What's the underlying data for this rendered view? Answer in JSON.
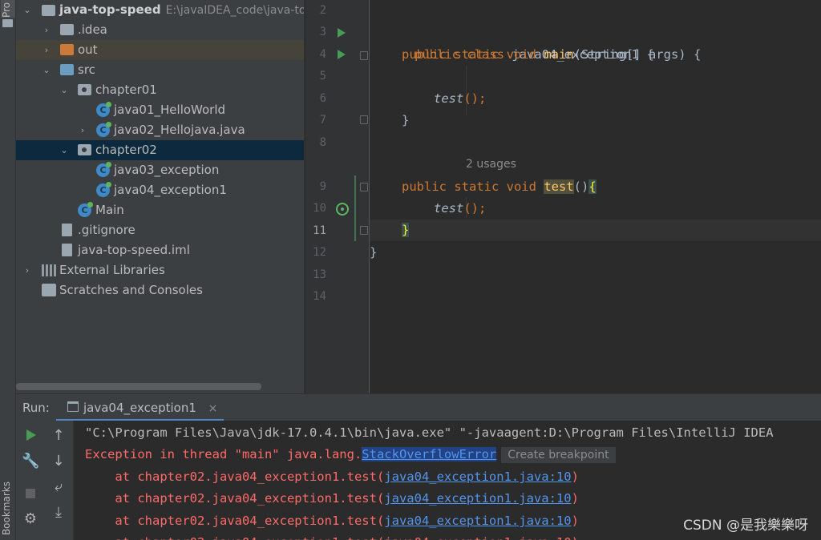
{
  "tool_stripe": {
    "project_label": "Pro",
    "bookmarks_label": "Bookmarks"
  },
  "project": {
    "root_name": "java-top-speed",
    "root_path": "E:\\javaIDEA_code\\java-top",
    "items": [
      {
        "label": "java-top-speed",
        "path": "E:\\javaIDEA_code\\java-top"
      },
      {
        "label": ".idea"
      },
      {
        "label": "out"
      },
      {
        "label": "src"
      },
      {
        "label": "chapter01"
      },
      {
        "label": "java01_HelloWorld"
      },
      {
        "label": "java02_Hellojava.java"
      },
      {
        "label": "chapter02"
      },
      {
        "label": "java03_exception"
      },
      {
        "label": "java04_exception1"
      },
      {
        "label": "Main"
      },
      {
        "label": ".gitignore"
      },
      {
        "label": "java-top-speed.iml"
      },
      {
        "label": "External Libraries"
      },
      {
        "label": "Scratches and Consoles"
      }
    ],
    "selected": "chapter02"
  },
  "editor": {
    "line_numbers": [
      "2",
      "3",
      "4",
      "5",
      "6",
      "7",
      "8",
      "9",
      "10",
      "11",
      "12",
      "13",
      "14"
    ],
    "current_line": "11",
    "usages_hint": "2 usages",
    "code": {
      "l3_public": "public",
      "l3_class": "class",
      "l3_name": " java04_exception1 {",
      "l4_mods": "public static void",
      "l4_main": "main",
      "l4_rest": "(String[] args) {",
      "l6_call": "test",
      "l6_rest": "();",
      "l7": "}",
      "l9_mods": "public static void",
      "l9_test": "test",
      "l9_parens": "()",
      "l9_brace": "{",
      "l10_call": "test",
      "l10_rest": "();",
      "l11": "}",
      "l12": "}"
    }
  },
  "run_panel": {
    "label": "Run:",
    "tab": "java04_exception1",
    "tab_close": "×",
    "console": {
      "cmd": "\"C:\\Program Files\\Java\\jdk-17.0.4.1\\bin\\java.exe\" \"-javaagent:D:\\Program Files\\IntelliJ IDEA",
      "exc_prefix": "Exception in thread \"main\" java.lang.",
      "exc_class": "StackOverflowError",
      "bp_hint": "Create breakpoint",
      "at_prefix": "    at chapter02.java04_exception1.test(",
      "at_link": "java04_exception1.java:10",
      "at_suffix": ")",
      "partial_line": "    at chapter02.java04_exception1.test(java04_exception1.java:10)"
    }
  },
  "watermark": "CSDN @是我樂樂呀",
  "colors": {
    "keyword": "#cc7832",
    "method": "#ffc66d",
    "error": "#ff6b68",
    "link": "#5394ec",
    "selection": "#0d293e"
  }
}
